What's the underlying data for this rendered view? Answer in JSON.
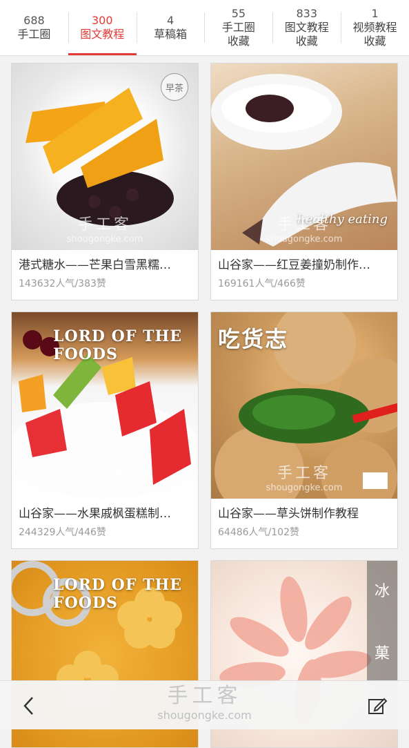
{
  "tabs": [
    {
      "count": "688",
      "label": "手工圈",
      "active": false
    },
    {
      "count": "300",
      "label": "图文教程",
      "active": true
    },
    {
      "count": "4",
      "label": "草稿箱",
      "active": false
    },
    {
      "count": "55",
      "label": "手工圈\n收藏",
      "active": false
    },
    {
      "count": "833",
      "label": "图文教程\n收藏",
      "active": false
    },
    {
      "count": "1",
      "label": "视频教程\n收藏",
      "active": false
    }
  ],
  "cards": [
    {
      "title": "港式糖水——芒果白雪黑糯…",
      "stats": "143632人气/383赞",
      "overlay": "早茶"
    },
    {
      "title": "山谷家——红豆姜撞奶制作…",
      "stats": "169161人气/466赞",
      "overlay": "healthy eating"
    },
    {
      "title": "山谷家——水果戚枫蛋糕制…",
      "stats": "244329人气/446赞",
      "overlay": "LORD OF THE FOODS"
    },
    {
      "title": "山谷家——草头饼制作教程",
      "stats": "64486人气/102赞",
      "overlay": "吃货志"
    },
    {
      "title": "",
      "stats": "",
      "overlay": "LORD OF THE FOODS"
    },
    {
      "title": "",
      "stats": "",
      "overlay": "冰 菓"
    }
  ],
  "watermark": {
    "cn": "手工客",
    "url": "shougongke.com"
  },
  "bottom": {
    "watermark_cn": "手工客",
    "watermark_url": "shougongke.com"
  }
}
